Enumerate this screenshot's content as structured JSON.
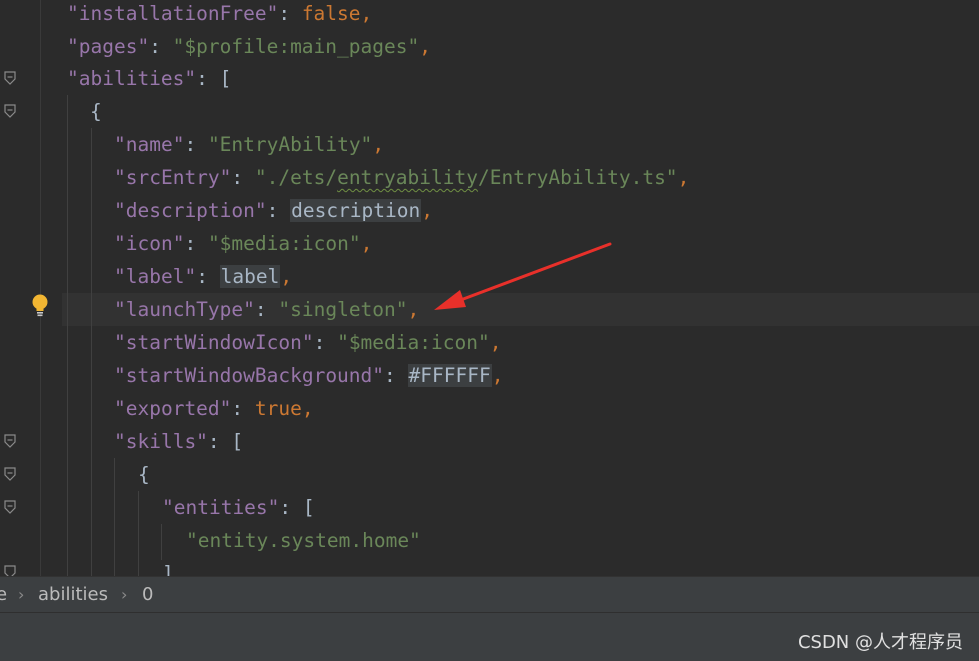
{
  "editor": {
    "lines": {
      "installationFree": {
        "key": "\"installationFree\"",
        "colon": ": ",
        "value": "false",
        "comma": ","
      },
      "pages": {
        "key": "\"pages\"",
        "colon": ": ",
        "value": "\"$profile:main_pages\"",
        "comma": ","
      },
      "abilities": {
        "key": "\"abilities\"",
        "colon": ": ",
        "bracket": "["
      },
      "open_brace": "{",
      "name": {
        "key": "\"name\"",
        "colon": ": ",
        "value": "\"EntryAbility\"",
        "comma": ","
      },
      "srcEntry": {
        "key": "\"srcEntry\"",
        "colon": ": ",
        "value_a": "\"./ets/",
        "value_b": "entryability",
        "value_c": "/EntryAbility.ts\"",
        "comma": ","
      },
      "description": {
        "key": "\"description\"",
        "colon": ": ",
        "value": "description",
        "comma": ","
      },
      "icon": {
        "key": "\"icon\"",
        "colon": ": ",
        "value": "\"$media:icon\"",
        "comma": ","
      },
      "label": {
        "key": "\"label\"",
        "colon": ": ",
        "value": "label",
        "comma": ","
      },
      "launchType": {
        "key": "\"launchType\"",
        "colon": ": ",
        "value": "\"singleton\"",
        "comma": ","
      },
      "startWindowIcon": {
        "key": "\"startWindowIcon\"",
        "colon": ": ",
        "value": "\"$media:icon\"",
        "comma": ","
      },
      "startWindowBackground": {
        "key": "\"startWindowBackground\"",
        "colon": ": ",
        "value": "#FFFFFF",
        "comma": ","
      },
      "exported": {
        "key": "\"exported\"",
        "colon": ": ",
        "value": "true",
        "comma": ","
      },
      "skills": {
        "key": "\"skills\"",
        "colon": ": ",
        "bracket": "["
      },
      "skills_open_brace": "{",
      "entities": {
        "key": "\"entities\"",
        "colon": ": ",
        "bracket": "["
      },
      "entity_value": "\"entity.system.home\"",
      "close_bracket": "]"
    }
  },
  "breadcrumbs": {
    "items": [
      "e",
      "abilities",
      "0"
    ],
    "separator": "›"
  },
  "watermark": "CSDN @人才程序员",
  "icons": {
    "fold": "fold-marker-icon",
    "bulb": "lightbulb-icon",
    "arrow": "red-annotation-arrow"
  },
  "colors": {
    "background": "#2b2b2b",
    "key": "#9876aa",
    "string": "#6a8759",
    "keyword": "#cc7832",
    "arrow": "#e8302a",
    "bulb": "#f2b632"
  }
}
